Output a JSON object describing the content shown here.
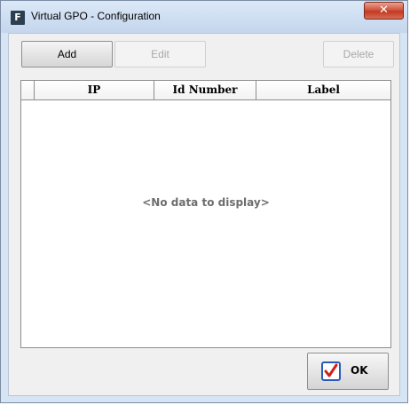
{
  "window": {
    "title": "Virtual GPO - Configuration",
    "app_icon": "F",
    "close_glyph": "✕"
  },
  "toolbar": {
    "add_label": "Add",
    "edit_label": "Edit",
    "delete_label": "Delete"
  },
  "grid": {
    "columns": [
      "IP",
      "Id Number",
      "Label"
    ],
    "empty_message": "<No data to display>"
  },
  "footer": {
    "ok_label": "OK",
    "ok_icon": "checkbox-check-icon"
  },
  "colors": {
    "title_bar": "#c4d6ed",
    "close_button": "#c23a22",
    "check_mark": "#d0201b",
    "checkbox_border": "#2a5ab8"
  }
}
